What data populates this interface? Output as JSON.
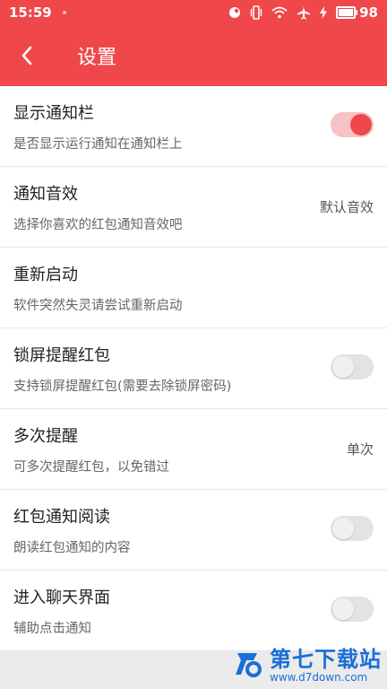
{
  "status_bar": {
    "time": "15:59",
    "battery_level": "98",
    "icons": [
      "notification-icon",
      "vibrate-icon",
      "wifi-icon",
      "airplane-icon",
      "charging-icon",
      "battery-icon"
    ]
  },
  "header": {
    "title": "设置",
    "back_icon": "chevron-left-icon"
  },
  "colors": {
    "accent": "#f0474b",
    "toggle_on_track": "#f7c2c3",
    "toggle_off_track": "#e3e3e3"
  },
  "settings": [
    {
      "title": "显示通知栏",
      "subtitle": "是否显示运行通知在通知栏上",
      "type": "toggle",
      "on": true
    },
    {
      "title": "通知音效",
      "subtitle": "选择你喜欢的红包通知音效吧",
      "type": "value",
      "value": "默认音效"
    },
    {
      "title": "重新启动",
      "subtitle": "软件突然失灵请尝试重新启动",
      "type": "none"
    },
    {
      "title": "锁屏提醒红包",
      "subtitle": "支持锁屏提醒红包(需要去除锁屏密码)",
      "type": "toggle",
      "on": false
    },
    {
      "title": "多次提醒",
      "subtitle": "可多次提醒红包，以免错过",
      "type": "value",
      "value": "单次"
    },
    {
      "title": "红包通知阅读",
      "subtitle": "朗读红包通知的内容",
      "type": "toggle",
      "on": false
    },
    {
      "title": "进入聊天界面",
      "subtitle": "辅助点击通知",
      "type": "toggle",
      "on": false
    }
  ],
  "watermark": {
    "title": "第七下载站",
    "url": "www.d7down.com"
  }
}
